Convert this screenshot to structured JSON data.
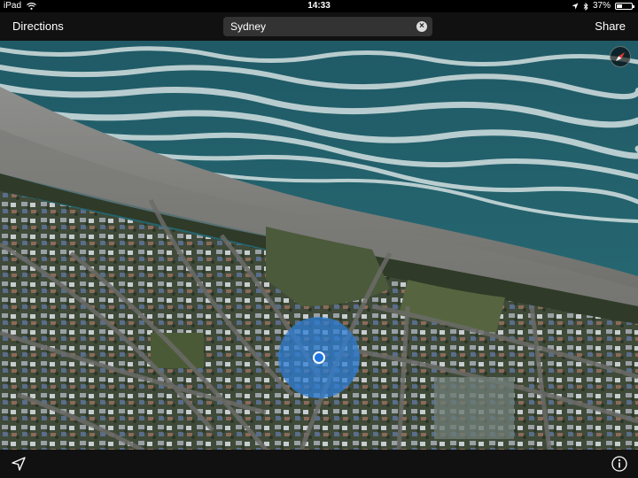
{
  "status_bar": {
    "device": "iPad",
    "time": "14:33",
    "battery": "37%",
    "battery_level": 0.37,
    "icons": [
      "wifi-icon",
      "location-arrow-icon",
      "bluetooth-icon",
      "battery-icon"
    ]
  },
  "nav_bar": {
    "directions_label": "Directions",
    "search_value": "Sydney",
    "share_label": "Share"
  },
  "map": {
    "view": "satellite",
    "current_location_accuracy": "large",
    "compass": "compass-icon"
  },
  "toolbar": {
    "icons": [
      "tracking-arrow-icon",
      "info-icon"
    ]
  },
  "colors": {
    "accent_blue": "#2f7fd6",
    "location_dot": "#1e74e0",
    "bar_background": "#111111"
  }
}
